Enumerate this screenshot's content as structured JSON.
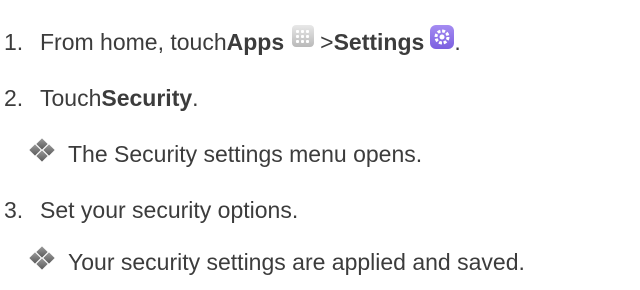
{
  "steps": [
    {
      "number": "1.",
      "text_a": "From home, touch ",
      "bold_a": "Apps",
      "text_b": " > ",
      "bold_b": "Settings",
      "text_c": "."
    },
    {
      "number": "2.",
      "text_a": "Touch ",
      "bold_a": "Security",
      "text_c": "."
    },
    {
      "result": "The Security settings menu opens."
    },
    {
      "number": "3.",
      "text_a": "Set your security options."
    },
    {
      "result": "Your security settings are applied and saved."
    }
  ],
  "icons": {
    "apps": "apps-grid-icon",
    "settings": "settings-gear-icon",
    "bullet": "diamond-bullet-icon"
  }
}
